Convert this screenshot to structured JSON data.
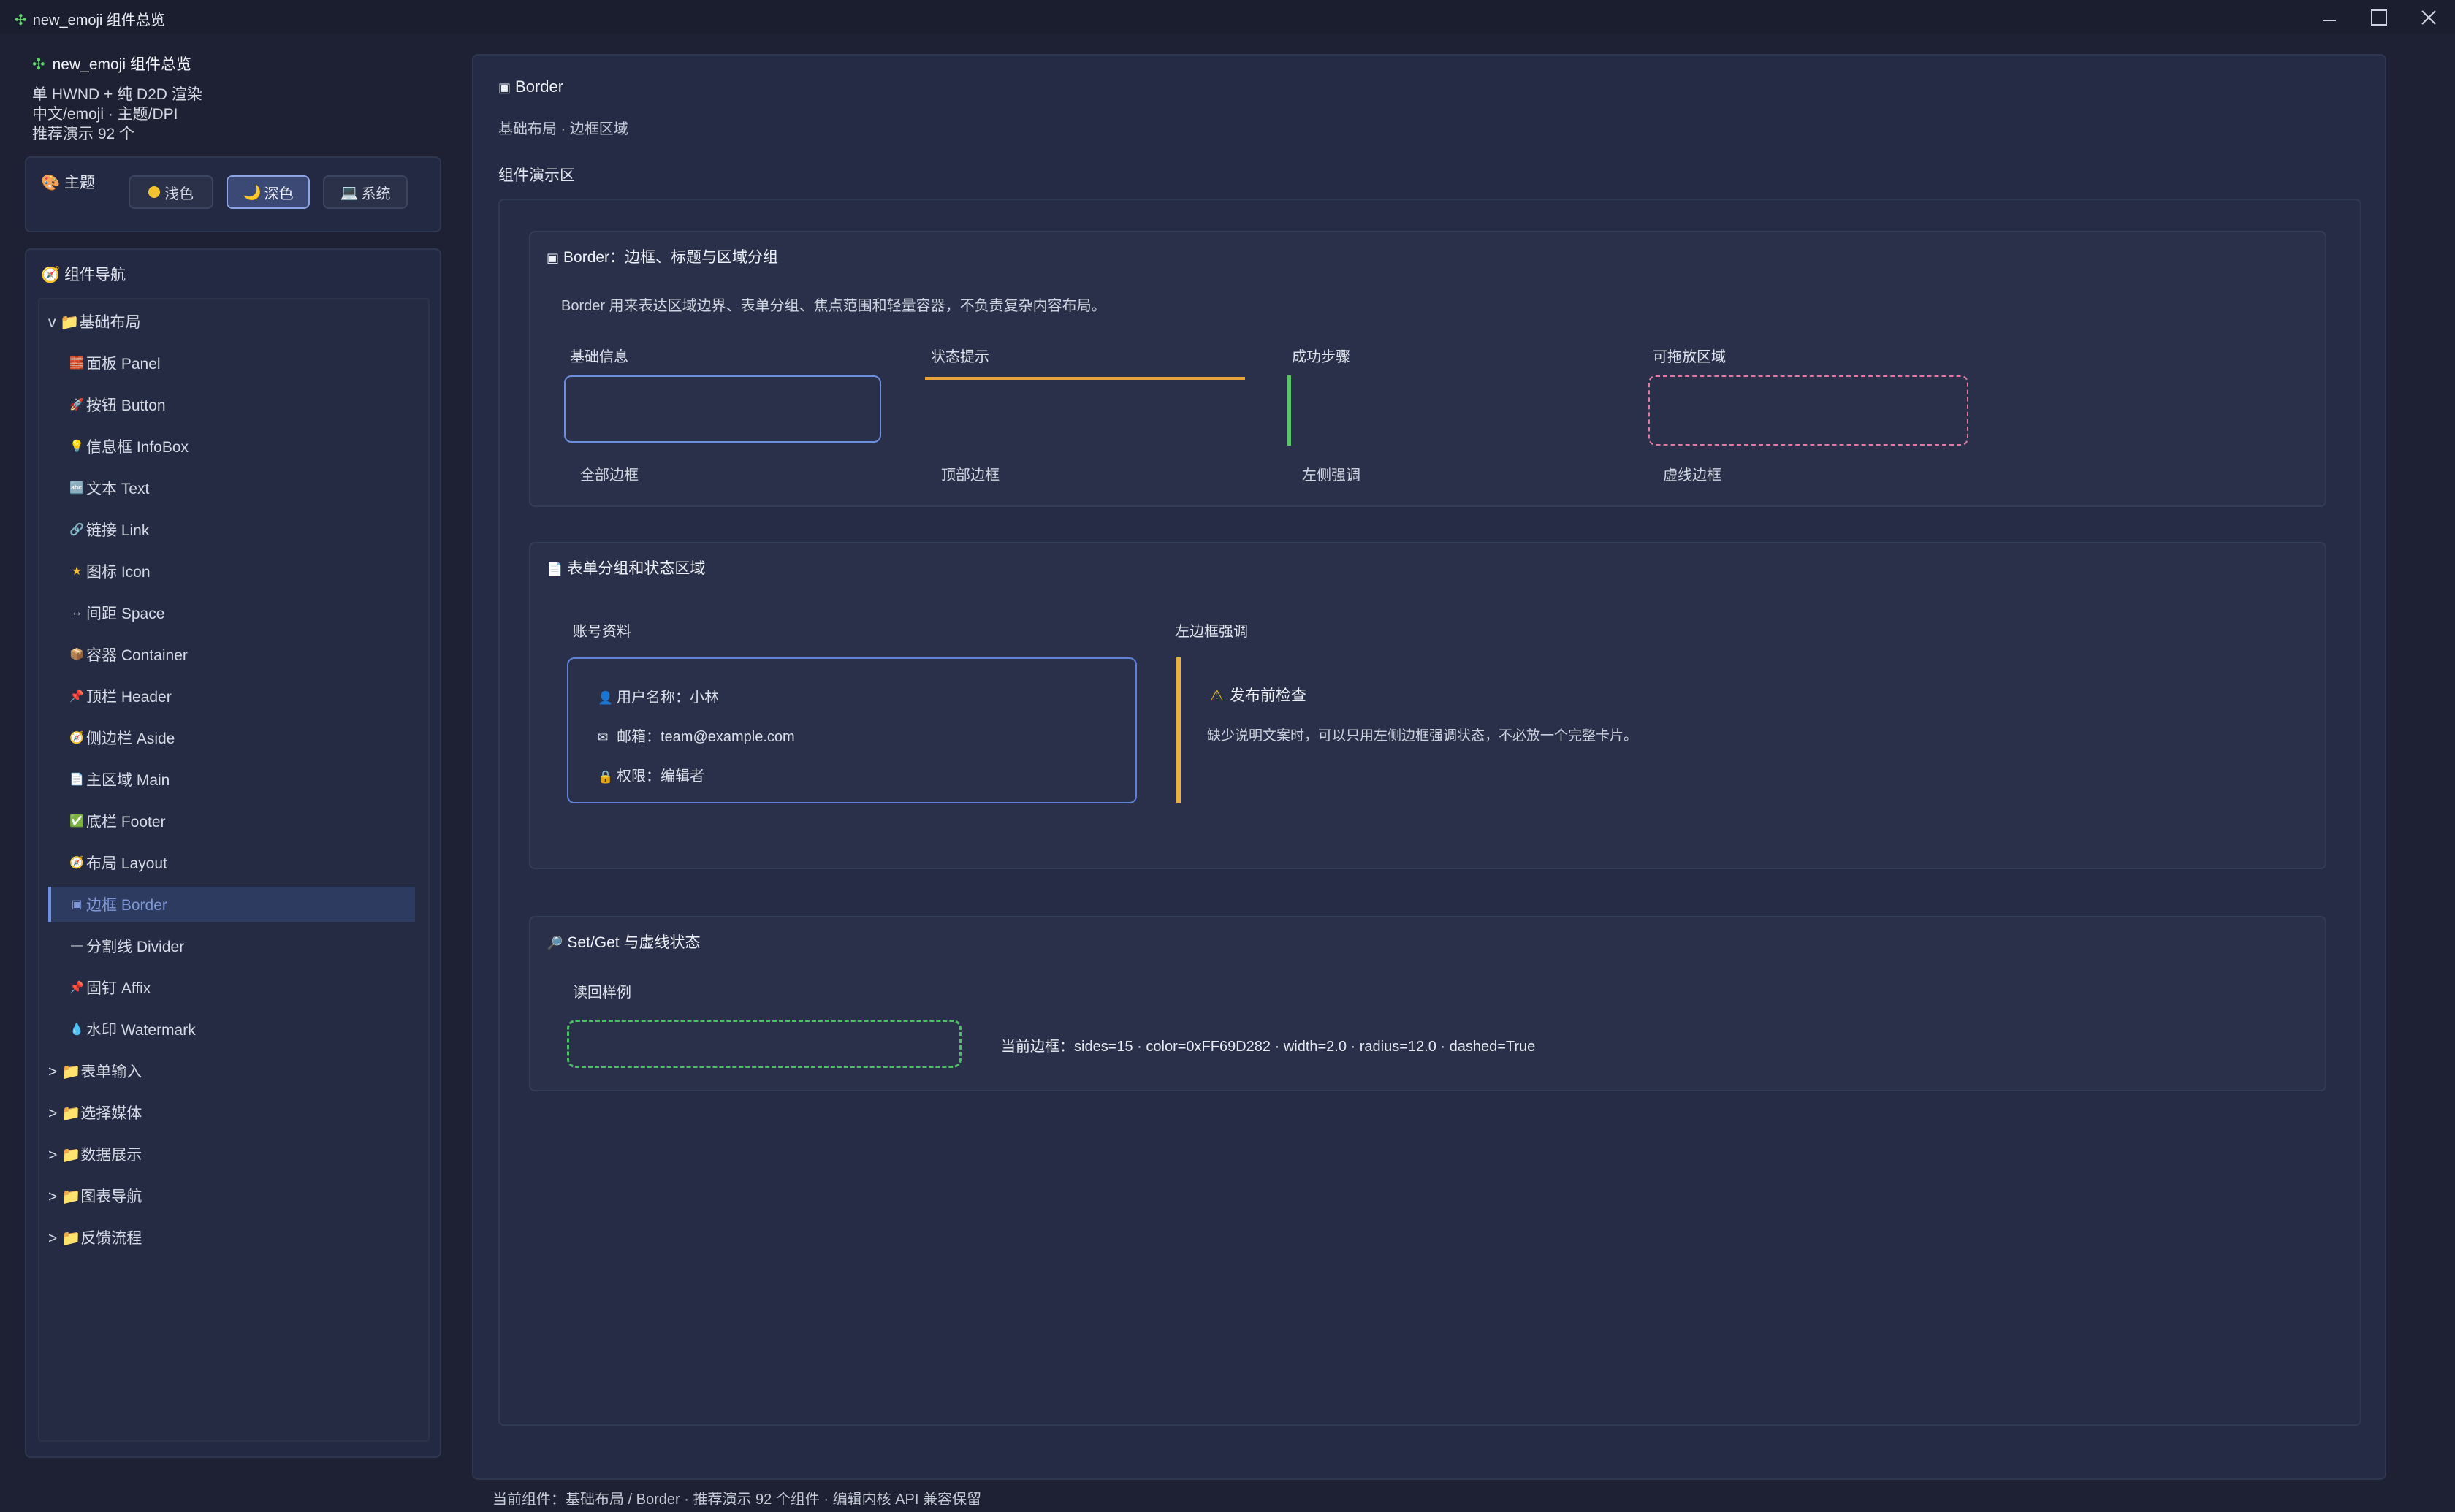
{
  "window": {
    "title": "new_emoji 组件总览"
  },
  "sidebar": {
    "header_title": "new_emoji 组件总览",
    "info_lines": [
      "单 HWND + 纯 D2D 渲染",
      "中文/emoji · 主题/DPI",
      "推荐演示 92 个"
    ],
    "theme": {
      "label": "主题",
      "options": [
        {
          "label": "浅色",
          "selected": false
        },
        {
          "label": "深色",
          "selected": true
        },
        {
          "label": "系统",
          "selected": false
        }
      ]
    },
    "nav": {
      "label": "组件导航",
      "items": [
        {
          "label": "v 📁基础布局"
        },
        {
          "label": "面板 Panel"
        },
        {
          "label": "按钮 Button"
        },
        {
          "label": "信息框 InfoBox"
        },
        {
          "label": "文本 Text"
        },
        {
          "label": "链接 Link"
        },
        {
          "label": "图标 Icon"
        },
        {
          "label": "间距 Space"
        },
        {
          "label": "容器 Container"
        },
        {
          "label": "顶栏 Header"
        },
        {
          "label": "侧边栏 Aside"
        },
        {
          "label": "主区域 Main"
        },
        {
          "label": "底栏 Footer"
        },
        {
          "label": "布局 Layout"
        },
        {
          "label": "边框 Border"
        },
        {
          "label": "分割线 Divider"
        },
        {
          "label": "固钉 Affix"
        },
        {
          "label": "水印 Watermark"
        },
        {
          "label": "> 📁表单输入"
        },
        {
          "label": "> 📁选择媒体"
        },
        {
          "label": "> 📁数据展示"
        },
        {
          "label": "> 📁图表导航"
        },
        {
          "label": "> 📁反馈流程"
        }
      ]
    }
  },
  "main": {
    "title": "Border",
    "subtitle": "基础布局 · 边框区域",
    "demo_label": "组件演示区",
    "section1": {
      "title": "Border：边框、标题与区域分组",
      "desc": "Border 用来表达区域边界、表单分组、焦点范围和轻量容器，不负责复杂内容布局。",
      "columns": [
        {
          "label": "基础信息",
          "caption": "全部边框"
        },
        {
          "label": "状态提示",
          "caption": "顶部边框"
        },
        {
          "label": "成功步骤",
          "caption": "左侧强调"
        },
        {
          "label": "可拖放区域",
          "caption": "虚线边框"
        }
      ]
    },
    "section2": {
      "title": "表单分组和状态区域",
      "account_label": "账号资料",
      "rows": [
        "用户名称：小林",
        "邮箱：team@example.com",
        "权限：编辑者"
      ],
      "accent_label": "左边框强调",
      "warn_title": "发布前检查",
      "warn_text": "缺少说明文案时，可以只用左侧边框强调状态，不必放一个完整卡片。"
    },
    "section3": {
      "title": "Set/Get 与虚线状态",
      "readback_label": "读回样例",
      "readback_value": "当前边框：sides=15 · color=0xFF69D282 · width=2.0 · radius=12.0 · dashed=True"
    }
  },
  "status_bar": "当前组件：基础布局 / Border · 推荐演示 92 个组件 · 编辑内核 API 兼容保留",
  "colors": {
    "background": "#1d2133",
    "accent": "#6c8fe0",
    "warning": "#e6a33a",
    "success": "#5dc46c",
    "dashed_pink": "#e07aa0",
    "dashed_green": "#4fbf67"
  }
}
